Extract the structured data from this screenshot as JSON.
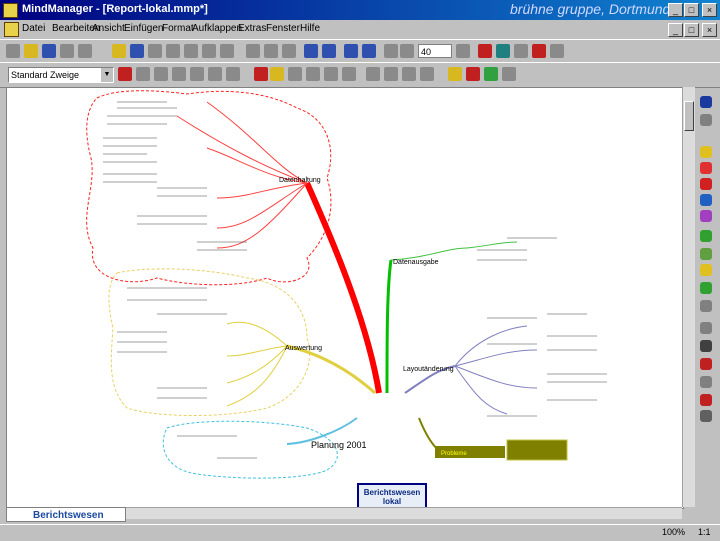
{
  "window": {
    "app_name": "MindManager",
    "title": "MindManager - [Report-lokal.mmp*]",
    "watermark": "brühne gruppe, Dortmund",
    "buttons": [
      "_",
      "□",
      "×"
    ]
  },
  "menu": [
    "Datei",
    "Bearbeiten",
    "Ansicht",
    "Einfügen",
    "Format",
    "Aufklappen",
    "Extras",
    "Fenster",
    "Hilfe"
  ],
  "toolbar": {
    "style_select": "Standard Zweige",
    "zoom": "40"
  },
  "map": {
    "central": "Berichtswesen lokal",
    "central_sub": "— — — — —",
    "branches": [
      {
        "label": "Datenhaltung",
        "color": "#ff0000"
      },
      {
        "label": "Datenausgabe",
        "color": "#00b000"
      },
      {
        "label": "Auswertung",
        "color": "#c0b000"
      },
      {
        "label": "Layoutänderung",
        "color": "#8080c0"
      },
      {
        "label": "Planung 2001",
        "color": "#40c0e0"
      },
      {
        "label": "Probleme",
        "color": "#808000"
      }
    ]
  },
  "tabs": {
    "active": "Berichtswesen lokal"
  },
  "status": {
    "zoom": "100%",
    "page": "1:1"
  },
  "colors": {
    "titlebar": "#000080",
    "accent_red": "#ff0000",
    "accent_green": "#00b000"
  }
}
